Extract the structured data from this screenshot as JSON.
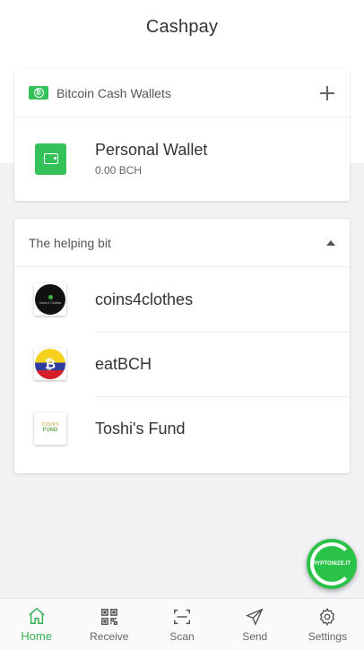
{
  "app": {
    "title": "Cashpay"
  },
  "wallets_card": {
    "title": "Bitcoin Cash Wallets",
    "wallets": [
      {
        "name": "Personal Wallet",
        "balance": "0.00 BCH"
      }
    ]
  },
  "helping_card": {
    "title": "The helping bit",
    "items": [
      {
        "name": "coins4clothes",
        "logo_text": "Coins 4 Clothes"
      },
      {
        "name": "eatBCH",
        "logo_text": "₿"
      },
      {
        "name": "Toshi's Fund",
        "logo_top": "TOSHI'S",
        "logo_bottom": "FUND"
      }
    ]
  },
  "fab": {
    "label": "RYPTONIZE.IT"
  },
  "bottom_nav": [
    {
      "label": "Home",
      "icon": "home-icon",
      "active": true
    },
    {
      "label": "Receive",
      "icon": "qr-code-icon",
      "active": false
    },
    {
      "label": "Scan",
      "icon": "scan-icon",
      "active": false
    },
    {
      "label": "Send",
      "icon": "send-icon",
      "active": false
    },
    {
      "label": "Settings",
      "icon": "gear-icon",
      "active": false
    }
  ],
  "colors": {
    "accent": "#35c15a",
    "background": "#f2f2f4",
    "card": "#ffffff"
  }
}
